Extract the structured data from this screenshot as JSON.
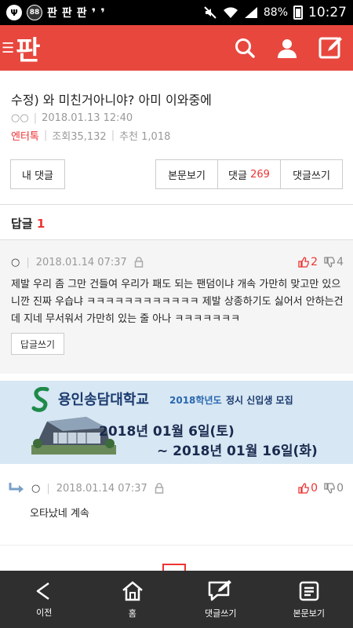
{
  "status_bar": {
    "badge": "88",
    "app_labels": [
      "판",
      "판",
      "판"
    ],
    "battery": "88%",
    "time": "10:27"
  },
  "header": {
    "logo": "판",
    "menu_icon": "menu-icon",
    "icons": [
      "search-icon",
      "user-icon",
      "edit-icon"
    ],
    "accent_color": "#e8473e"
  },
  "article": {
    "title": "수정) 와 미친거아니야? 아미 이와중에",
    "author": "○○",
    "date": "2018.01.13 12:40",
    "category": "엔터톡",
    "views": "조회35,132",
    "recommend": "추천 1,018"
  },
  "buttons": {
    "my_comments": "내 댓글",
    "view_body": "본문보기",
    "comments_label": "댓글",
    "comments_count": "269",
    "write_comment": "댓글쓰기"
  },
  "reply_section": {
    "label": "답글",
    "count": "1"
  },
  "comments": [
    {
      "user": "○",
      "date": "2018.01.14 07:37",
      "up": "2",
      "down": "4",
      "body": "제발 우리 좀 그만 건들여 우리가 패도 되는 팬덤이냐 개속 가만히 맞고만 있으니깐 진짜 우습냐 ㅋㅋㅋㅋㅋㅋㅋㅋㅋㅋㅋㅋ 제발 상종하기도 싫어서 안하는건데 지네 무서워서 가만히 있는 줄 아나 ㅋㅋㅋㅋㅋㅋㅋ",
      "reply_button": "답글쓰기"
    },
    {
      "user": "○",
      "date": "2018.01.14 07:37",
      "up": "0",
      "down": "0",
      "body": "오타났네 계속"
    }
  ],
  "ad": {
    "school": "용인송담대학교",
    "year": "2018학년도",
    "recruit": "정시 신입생 모집",
    "date_start": "2018년 01월 6일(토)",
    "date_end": "~  2018년 01월 16일(화)"
  },
  "bottom_nav": [
    {
      "label": "이전",
      "icon": "back-icon"
    },
    {
      "label": "홈",
      "icon": "home-icon"
    },
    {
      "label": "댓글쓰기",
      "icon": "comment-write-icon"
    },
    {
      "label": "본문보기",
      "icon": "document-icon"
    }
  ]
}
